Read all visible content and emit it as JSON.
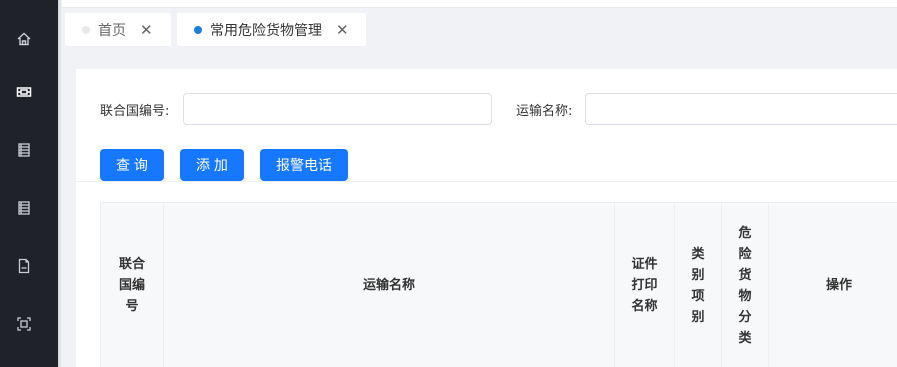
{
  "sidebar": {
    "icons": [
      "home-icon",
      "film-icon",
      "list-icon",
      "list-icon",
      "file-icon",
      "scan-icon"
    ]
  },
  "tabs": [
    {
      "label": "首页"
    },
    {
      "label": "常用危险货物管理"
    }
  ],
  "tab_close_glyph": "✕",
  "search": {
    "un_label": "联合国编号:",
    "un_value": "",
    "name_label": "运输名称:",
    "name_value": ""
  },
  "buttons": {
    "query": "查 询",
    "add": "添 加",
    "alarm": "报警电话"
  },
  "table": {
    "headers": [
      "联合\n国编\n号",
      "运输名称",
      "证件\n打印\n名称",
      "类\n别\n项\n别",
      "危\n险\n货\n物\n分\n类",
      "操作"
    ]
  },
  "colors": {
    "primary": "#1677ff",
    "sidebar": "#20222a",
    "active_dot": "#1e7fd8"
  }
}
